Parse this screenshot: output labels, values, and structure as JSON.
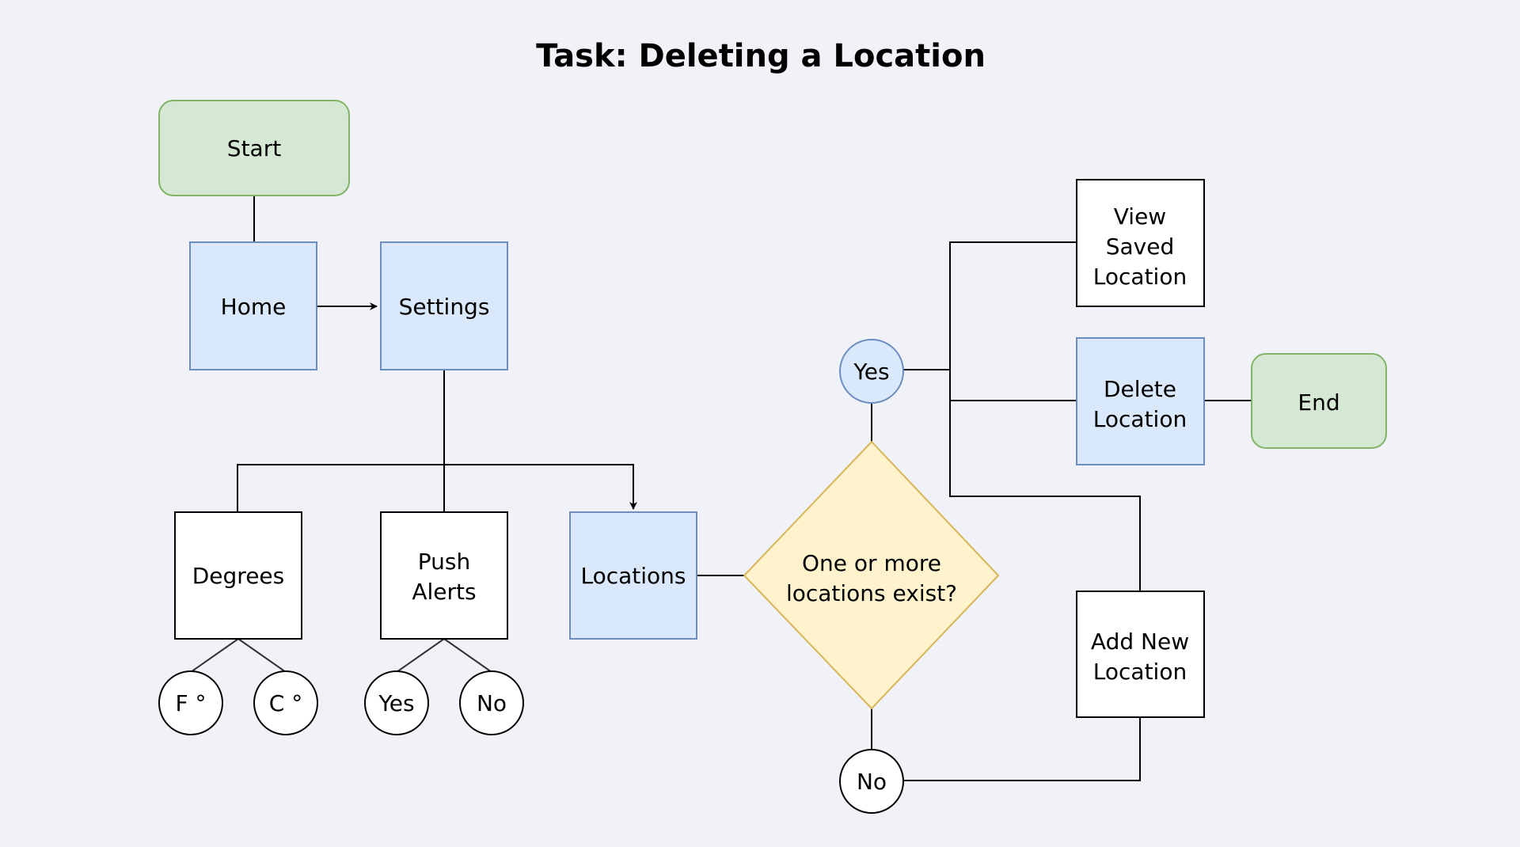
{
  "title": "Task: Deleting a Location",
  "colors": {
    "background": "#f1f2f8",
    "terminal_fill": "#d5e8d4",
    "terminal_stroke": "#82b366",
    "screen_fill": "#dae8fc",
    "screen_stroke": "#6c8ebf",
    "option_fill": "#ffffff",
    "option_stroke": "#000000",
    "decision_fill": "#fff2cc",
    "decision_stroke": "#d6b656"
  },
  "nodes": {
    "start": {
      "lines": [
        "Start"
      ],
      "kind": "terminal"
    },
    "home": {
      "lines": [
        "Home"
      ],
      "kind": "screen"
    },
    "settings": {
      "lines": [
        "Settings"
      ],
      "kind": "screen"
    },
    "degrees": {
      "lines": [
        "Degrees"
      ],
      "kind": "option"
    },
    "push_alerts": {
      "lines": [
        "Push",
        "Alerts"
      ],
      "kind": "option"
    },
    "locations": {
      "lines": [
        "Locations"
      ],
      "kind": "screen"
    },
    "deg_f": {
      "lines": [
        "F °"
      ],
      "kind": "option-circle"
    },
    "deg_c": {
      "lines": [
        "C °"
      ],
      "kind": "option-circle"
    },
    "push_yes": {
      "lines": [
        "Yes"
      ],
      "kind": "option-circle"
    },
    "push_no": {
      "lines": [
        "No"
      ],
      "kind": "option-circle"
    },
    "decision": {
      "lines": [
        "One or more",
        "locations exist?"
      ],
      "kind": "decision"
    },
    "yes": {
      "lines": [
        "Yes"
      ],
      "kind": "screen-circle"
    },
    "no": {
      "lines": [
        "No"
      ],
      "kind": "option-circle"
    },
    "view_saved": {
      "lines": [
        "View",
        "Saved",
        "Location"
      ],
      "kind": "option"
    },
    "delete_location": {
      "lines": [
        "Delete",
        "Location"
      ],
      "kind": "screen"
    },
    "end": {
      "lines": [
        "End"
      ],
      "kind": "terminal"
    },
    "add_new": {
      "lines": [
        "Add New",
        "Location"
      ],
      "kind": "option"
    }
  },
  "edges": [
    {
      "from": "start",
      "to": "home",
      "arrow": false
    },
    {
      "from": "home",
      "to": "settings",
      "arrow": true
    },
    {
      "from": "settings",
      "to": "degrees",
      "arrow": false
    },
    {
      "from": "settings",
      "to": "push_alerts",
      "arrow": false
    },
    {
      "from": "settings",
      "to": "locations",
      "arrow": true
    },
    {
      "from": "degrees",
      "to": "deg_f",
      "arrow": false
    },
    {
      "from": "degrees",
      "to": "deg_c",
      "arrow": false
    },
    {
      "from": "push_alerts",
      "to": "push_yes",
      "arrow": false
    },
    {
      "from": "push_alerts",
      "to": "push_no",
      "arrow": false
    },
    {
      "from": "locations",
      "to": "decision",
      "arrow": false
    },
    {
      "from": "decision",
      "to": "yes",
      "arrow": false
    },
    {
      "from": "decision",
      "to": "no",
      "arrow": false
    },
    {
      "from": "yes",
      "to": "view_saved",
      "arrow": false
    },
    {
      "from": "yes",
      "to": "delete_location",
      "arrow": false
    },
    {
      "from": "yes",
      "to": "add_new",
      "arrow": false
    },
    {
      "from": "delete_location",
      "to": "end",
      "arrow": false
    },
    {
      "from": "no",
      "to": "add_new",
      "arrow": false
    }
  ]
}
